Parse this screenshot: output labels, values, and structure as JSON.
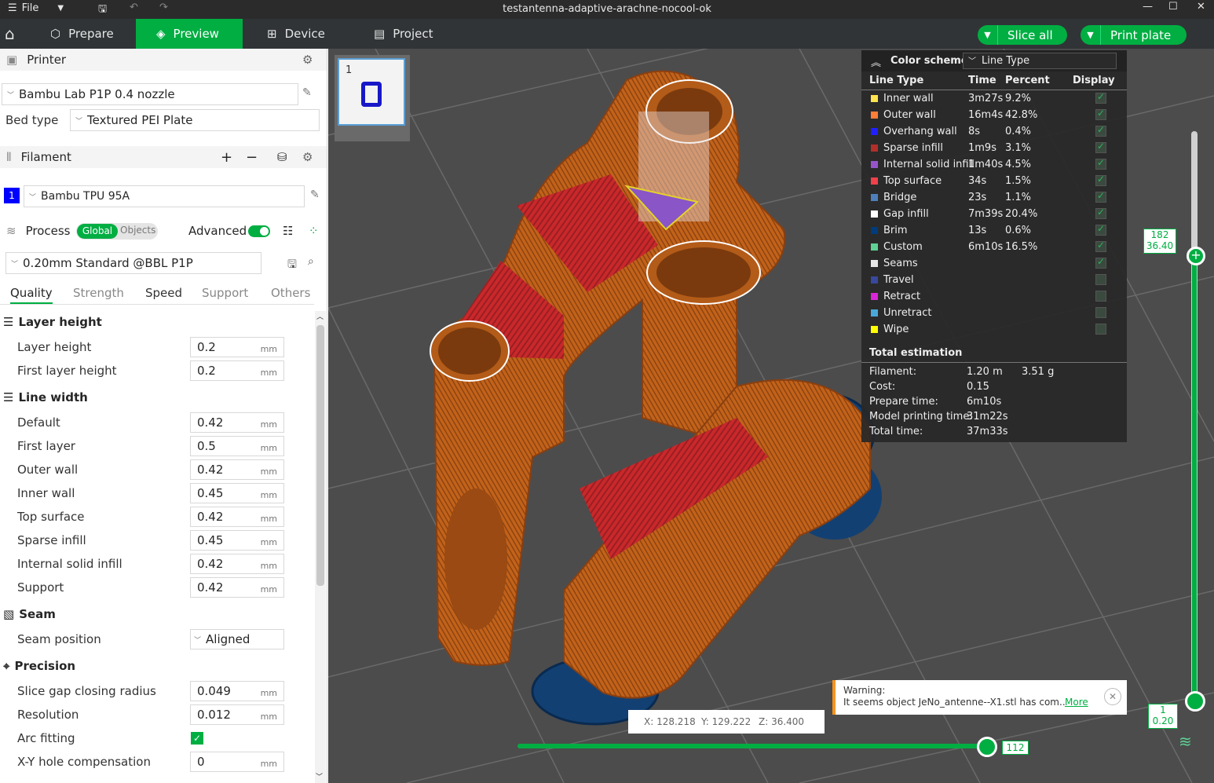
{
  "window": {
    "title": "testantenna-adaptive-arachne-nocool-ok",
    "file_label": "File"
  },
  "tabs": [
    {
      "label": "Prepare"
    },
    {
      "label": "Preview"
    },
    {
      "label": "Device"
    },
    {
      "label": "Project"
    }
  ],
  "actions": {
    "slice_all": "Slice all",
    "print_plate": "Print plate"
  },
  "printer": {
    "header": "Printer",
    "name": "Bambu Lab P1P 0.4 nozzle",
    "bed_label": "Bed type",
    "bed_value": "Textured PEI Plate"
  },
  "filament": {
    "header": "Filament",
    "slot": "1",
    "name": "Bambu TPU 95A",
    "slot_color": "#0000ff"
  },
  "process": {
    "header": "Process",
    "global": "Global",
    "objects": "Objects",
    "advanced": "Advanced",
    "preset": "0.20mm Standard @BBL P1P",
    "subtabs": [
      "Quality",
      "Strength",
      "Speed",
      "Support",
      "Others"
    ]
  },
  "quality": {
    "groups": {
      "layer_height": "Layer height",
      "line_width": "Line width",
      "seam": "Seam",
      "precision": "Precision"
    },
    "unit": "mm",
    "rows": [
      {
        "label": "Layer height",
        "value": "0.2"
      },
      {
        "label": "First layer height",
        "value": "0.2"
      },
      {
        "label": "Default",
        "value": "0.42"
      },
      {
        "label": "First layer",
        "value": "0.5"
      },
      {
        "label": "Outer wall",
        "value": "0.42"
      },
      {
        "label": "Inner wall",
        "value": "0.45"
      },
      {
        "label": "Top surface",
        "value": "0.42"
      },
      {
        "label": "Sparse infill",
        "value": "0.45"
      },
      {
        "label": "Internal solid infill",
        "value": "0.42"
      },
      {
        "label": "Support",
        "value": "0.42"
      },
      {
        "label": "Seam position",
        "value": "Aligned"
      },
      {
        "label": "Slice gap closing radius",
        "value": "0.049"
      },
      {
        "label": "Resolution",
        "value": "0.012"
      },
      {
        "label": "Arc fitting",
        "value": ""
      },
      {
        "label": "X-Y hole compensation",
        "value": "0"
      }
    ]
  },
  "plate": {
    "number": "1"
  },
  "legend": {
    "scheme_label": "Color scheme",
    "scheme_value": "Line Type",
    "cols": [
      "Line Type",
      "Time",
      "Percent",
      "Display"
    ],
    "rows": [
      {
        "name": "Inner wall",
        "time": "3m27s",
        "pct": "9.2%",
        "color": "#ffe44d",
        "on": true
      },
      {
        "name": "Outer wall",
        "time": "16m4s",
        "pct": "42.8%",
        "color": "#ff7d38",
        "on": true
      },
      {
        "name": "Overhang wall",
        "time": "8s",
        "pct": "0.4%",
        "color": "#1f1fff",
        "on": true
      },
      {
        "name": "Sparse infill",
        "time": "1m9s",
        "pct": "3.1%",
        "color": "#b03029",
        "on": true
      },
      {
        "name": "Internal solid infill",
        "time": "1m40s",
        "pct": "4.5%",
        "color": "#9654cc",
        "on": true
      },
      {
        "name": "Top surface",
        "time": "34s",
        "pct": "1.5%",
        "color": "#f0404a",
        "on": true
      },
      {
        "name": "Bridge",
        "time": "23s",
        "pct": "1.1%",
        "color": "#4d80ba",
        "on": true
      },
      {
        "name": "Gap infill",
        "time": "7m39s",
        "pct": "20.4%",
        "color": "#ffffff",
        "on": true
      },
      {
        "name": "Brim",
        "time": "13s",
        "pct": "0.6%",
        "color": "#003c7a",
        "on": true
      },
      {
        "name": "Custom",
        "time": "6m10s",
        "pct": "16.5%",
        "color": "#5ed194",
        "on": true
      },
      {
        "name": "Seams",
        "time": "",
        "pct": "",
        "color": "#e6e6e6",
        "on": true
      },
      {
        "name": "Travel",
        "time": "",
        "pct": "",
        "color": "#38489e",
        "on": false
      },
      {
        "name": "Retract",
        "time": "",
        "pct": "",
        "color": "#d926d9",
        "on": false
      },
      {
        "name": "Unretract",
        "time": "",
        "pct": "",
        "color": "#4aa8d9",
        "on": false
      },
      {
        "name": "Wipe",
        "time": "",
        "pct": "",
        "color": "#ffff00",
        "on": false
      }
    ],
    "total_header": "Total estimation",
    "totals": [
      {
        "k": "Filament:",
        "v": "1.20 m",
        "v2": "3.51 g"
      },
      {
        "k": "Cost:",
        "v": "0.15",
        "v2": ""
      },
      {
        "k": "Prepare time:",
        "v": "6m10s",
        "v2": ""
      },
      {
        "k": "Model printing time:",
        "v": "31m22s",
        "v2": ""
      },
      {
        "k": "Total time:",
        "v": "37m33s",
        "v2": ""
      }
    ]
  },
  "warning": {
    "title": "Warning:",
    "text": "It seems object JeNo_antenne--X1.stl has com..",
    "more": "More"
  },
  "coords": {
    "x": "X: 128.218",
    "y": "Y: 129.222",
    "z": "Z: 36.400"
  },
  "slider": {
    "top_layer": "182",
    "top_height": "36.40",
    "bottom_layer": "1",
    "bottom_height": "0.20",
    "h_value": "112"
  }
}
